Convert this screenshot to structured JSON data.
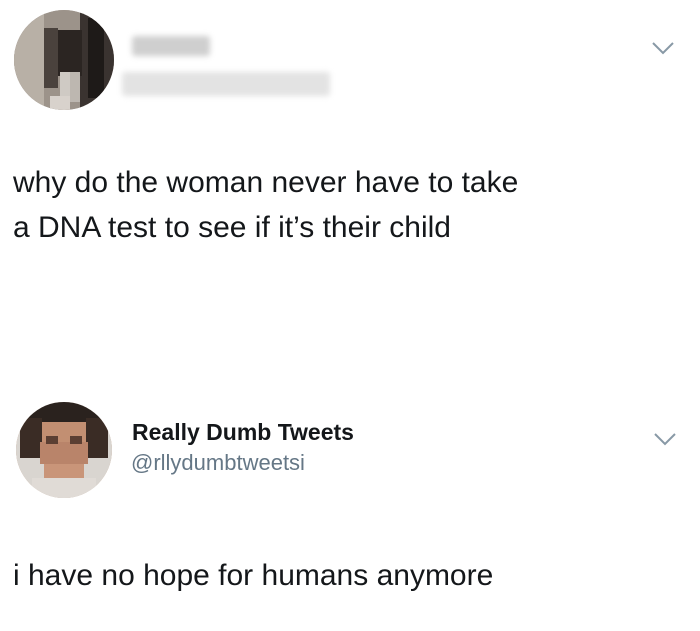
{
  "tweets": [
    {
      "author": {
        "name": "",
        "handle": "",
        "avatar": "pixelated-photo"
      },
      "menu_icon": "chevron-down-icon",
      "text_lines": [
        "why do the woman never have to take",
        "a DNA test to see if it’s their child"
      ]
    },
    {
      "author": {
        "name": "Really Dumb Tweets",
        "handle": "@rllydumbtweetsi",
        "avatar": "pixelated-face"
      },
      "menu_icon": "chevron-down-icon",
      "text": "i have no hope for humans anymore"
    }
  ],
  "colors": {
    "text": "#14171a",
    "handle": "#657786",
    "chevron": "#8899a6",
    "background": "#ffffff"
  }
}
